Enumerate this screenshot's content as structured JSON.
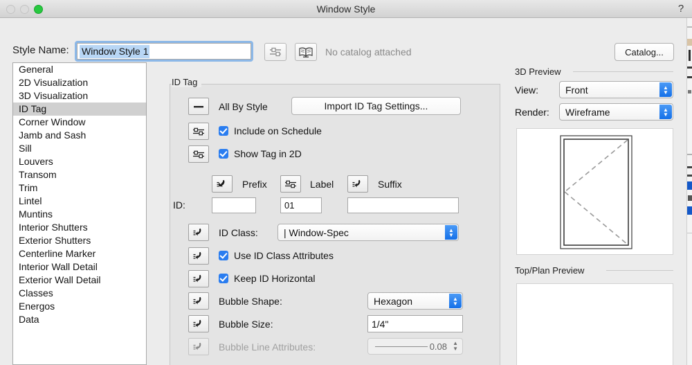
{
  "titlebar": {
    "title": "Window Style",
    "help_label": "?",
    "buttons": [
      "close",
      "minimize",
      "zoom"
    ]
  },
  "toolbar": {
    "style_name_label": "Style Name:",
    "style_name_value": "Window Style 1",
    "catalog_status": "No catalog attached",
    "catalog_button": "Catalog...",
    "slider_icon": "sliders-icon",
    "catalog_icon": "book-icon"
  },
  "sidebar": {
    "selected": "ID Tag",
    "items": [
      "General",
      "2D Visualization",
      "3D Visualization",
      "ID Tag",
      "Corner Window",
      "Jamb and Sash",
      "Sill",
      "Louvers",
      "Transom",
      "Trim",
      "Lintel",
      "Muntins",
      "Interior Shutters",
      "Exterior Shutters",
      "Centerline Marker",
      "Interior Wall Detail",
      "Exterior Wall Detail",
      "Classes",
      "Energos",
      "Data"
    ]
  },
  "main": {
    "group_title": "ID Tag",
    "all_by_style_label": "All By Style",
    "all_by_style_icon": "dash-icon",
    "import_button": "Import ID Tag Settings...",
    "include_on_schedule": {
      "label": "Include on Schedule",
      "checked": true,
      "icon": "sliders-icon"
    },
    "show_tag_in_2d": {
      "label": "Show Tag in 2D",
      "checked": true,
      "icon": "sliders-icon"
    },
    "id_row": {
      "id_label": "ID:",
      "prefix_label": "Prefix",
      "prefix_icon": "hook-icon",
      "prefix_value": "",
      "label_label": "Label",
      "label_icon": "sliders-icon",
      "label_value": "01",
      "suffix_label": "Suffix",
      "suffix_icon": "hook-icon",
      "suffix_value": ""
    },
    "id_class": {
      "label": "ID Class:",
      "value": "| Window-Spec",
      "icon": "hook-icon"
    },
    "use_id_class_attributes": {
      "label": "Use ID Class Attributes",
      "checked": true,
      "icon": "hook-icon"
    },
    "keep_id_horizontal": {
      "label": "Keep ID Horizontal",
      "checked": true,
      "icon": "hook-icon"
    },
    "bubble_shape": {
      "label": "Bubble Shape:",
      "value": "Hexagon",
      "icon": "hook-icon"
    },
    "bubble_size": {
      "label": "Bubble Size:",
      "value": "1/4\"",
      "icon": "hook-icon"
    },
    "bubble_line_attributes": {
      "label": "Bubble Line Attributes:",
      "value": "0.08",
      "icon": "hook-icon",
      "disabled": true
    }
  },
  "right": {
    "preview3d_title": "3D Preview",
    "view_label": "View:",
    "view_value": "Front",
    "render_label": "Render:",
    "render_value": "Wireframe",
    "topplan_title": "Top/Plan Preview"
  },
  "colors": {
    "accent": "#2a7df0",
    "popup_arrow": "#1470e8",
    "selection": "#b8d6f5",
    "sidebar_selected": "#d0d0d0",
    "window_bg": "#ececec",
    "group_bg": "#e4e4e4",
    "zoom_button": "#28c940"
  }
}
